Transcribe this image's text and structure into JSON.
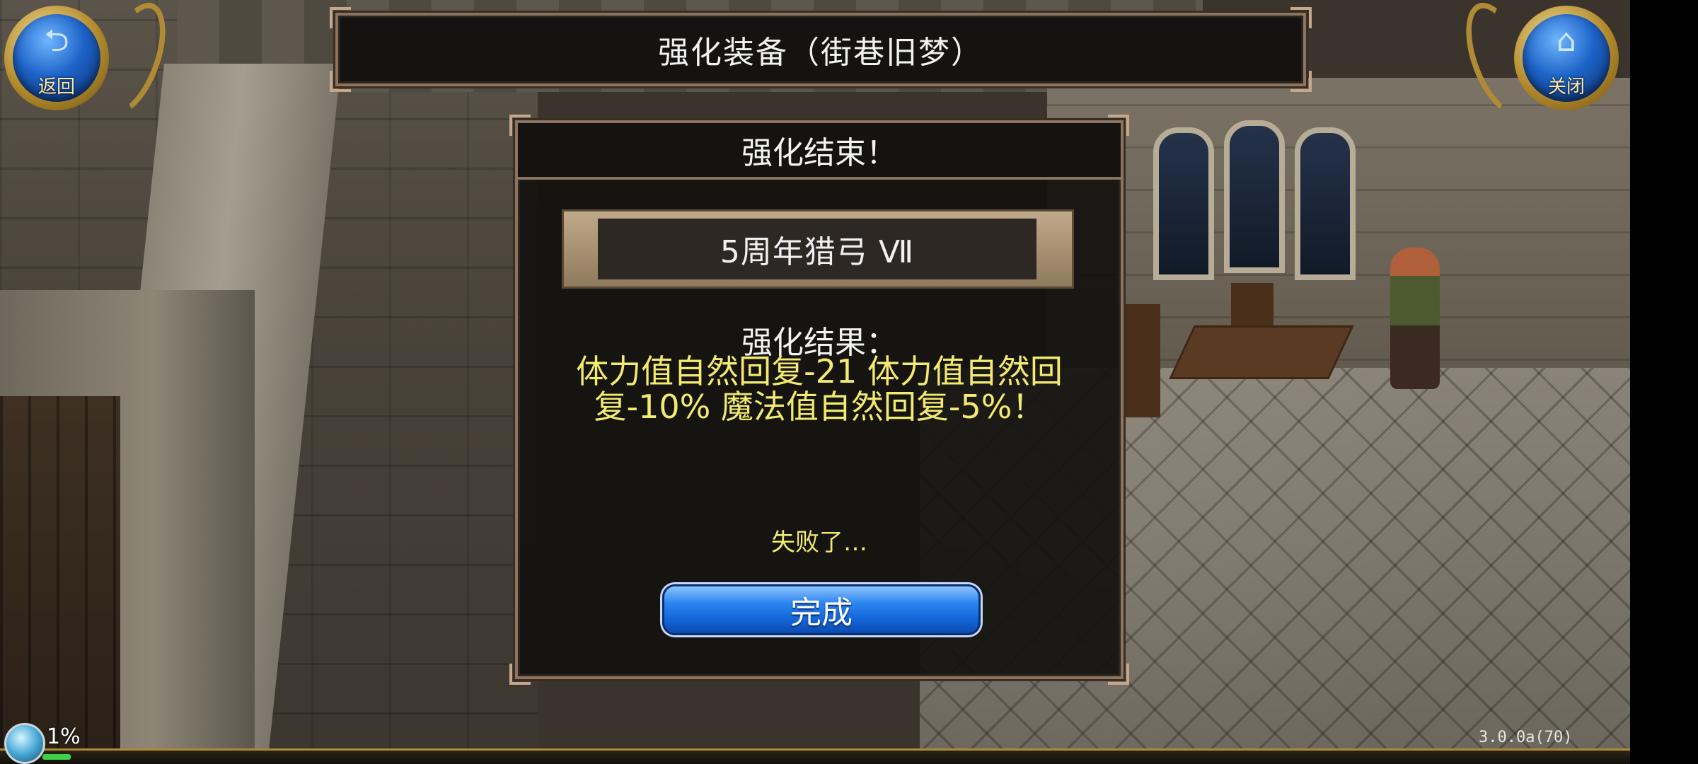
{
  "nav": {
    "back": {
      "icon": "back-arrow-icon",
      "label": "返回"
    },
    "close": {
      "icon": "home-icon",
      "label": "关闭"
    }
  },
  "title": "强化装备（街巷旧梦）",
  "dialog": {
    "title": "强化结束！",
    "item_name": "5周年猎弓 Ⅶ",
    "result_label": "强化结果：",
    "result_text": "体力值自然回复-21 体力值自然回复-10% 魔法值自然回复-5%！",
    "status": "失败了…",
    "done_label": "完成"
  },
  "hud": {
    "exp_percent": "1%",
    "exp_fraction": 0.01,
    "version": "3.0.0a(70)"
  },
  "colors": {
    "result_text": "#f3ea70",
    "button_blue": "#1366d8",
    "frame_border": "#8c7460"
  }
}
